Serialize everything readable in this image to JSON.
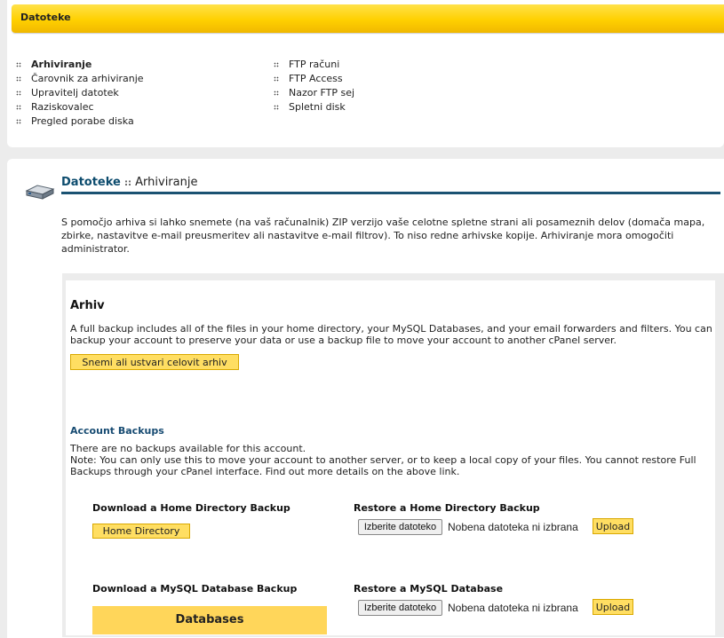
{
  "header": {
    "title": "Datoteke"
  },
  "nav": {
    "left": [
      {
        "label": "Arhiviranje",
        "active": true
      },
      {
        "label": "Čarovnik za arhiviranje",
        "active": false
      },
      {
        "label": "Upravitelj datotek",
        "active": false
      },
      {
        "label": "Raziskovalec",
        "active": false
      },
      {
        "label": "Pregled porabe diska",
        "active": false
      }
    ],
    "right": [
      {
        "label": "FTP računi"
      },
      {
        "label": "FTP Access"
      },
      {
        "label": "Nazor FTP sej"
      },
      {
        "label": "Spletni disk"
      }
    ]
  },
  "page": {
    "section": "Datoteke",
    "separator": "::",
    "subsection": "Arhiviranje",
    "intro": "S pomočjo arhiva si lahko snemete (na vaš računalnik) ZIP verzijo vaše celotne spletne strani ali posameznih delov (domača mapa, zbirke, nastavitve e-mail preusmeritev ali nastavitve e-mail filtrov). To niso redne arhivske kopije. Arhiviranje mora omogočiti administrator."
  },
  "archive": {
    "heading": "Arhiv",
    "description": "A full backup includes all of the files in your home directory, your MySQL Databases, and your email forwarders and filters. You can backup your account to preserve your data or use a backup file to move your account to another cPanel server.",
    "full_backup_button": "Snemi ali ustvari celovit arhiv"
  },
  "account_backups": {
    "heading": "Account Backups",
    "no_backups": "There are no backups available for this account.",
    "note": "Note: You can only use this to move your account to another server, or to keep a local copy of your files. You cannot restore Full Backups through your cPanel interface. Find out more details on the above link."
  },
  "home_dir": {
    "download_heading": "Download a Home Directory Backup",
    "download_button": "Home Directory",
    "restore_heading": "Restore a Home Directory Backup",
    "choose_file": "Izberite datoteko",
    "no_file": "Nobena datoteka ni izbrana",
    "upload": "Upload"
  },
  "mysql": {
    "download_heading": "Download a MySQL Database Backup",
    "databases_label": "Databases",
    "restore_heading": "Restore a MySQL Database",
    "choose_file": "Izberite datoteko",
    "no_file": "Nobena datoteka ni izbrana",
    "upload": "Upload"
  },
  "colors": {
    "accent_yellow": "#ffd000",
    "button_yellow": "#ffde62",
    "heading_blue": "#0d4c6e",
    "page_bg": "#ececec"
  }
}
